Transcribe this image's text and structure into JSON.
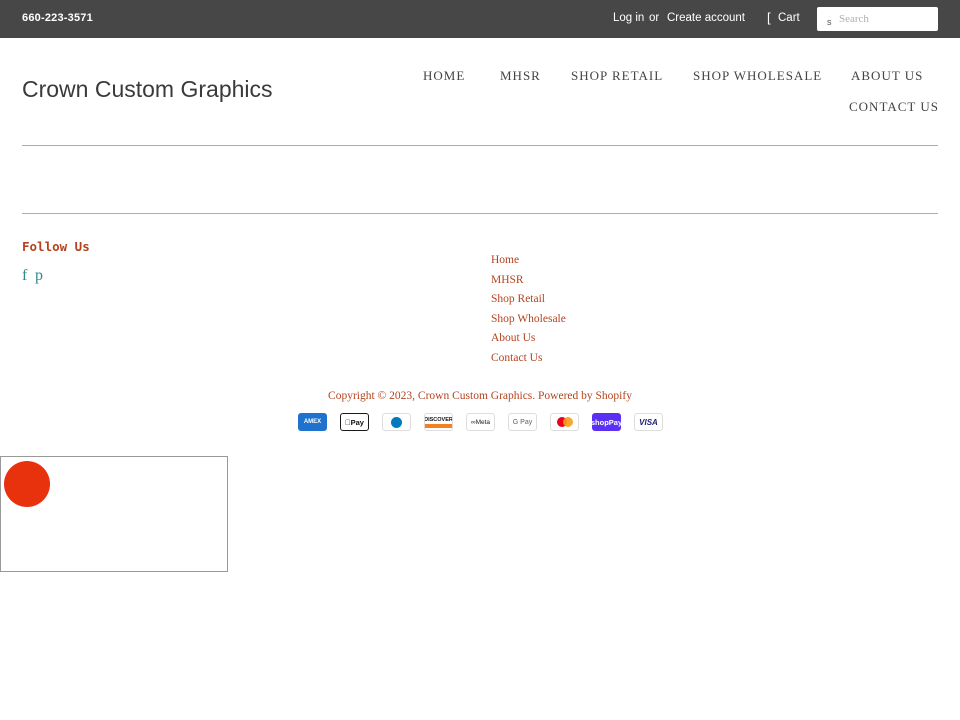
{
  "topbar": {
    "phone": "660-223-3571",
    "login_label": "Log in",
    "or_label": "or",
    "create_account_label": "Create account",
    "cart_icon_glyph": "[",
    "cart_label": "Cart",
    "search_icon_glyph": "s",
    "search_placeholder": "Search"
  },
  "header": {
    "logo_text": "Crown Custom Graphics"
  },
  "nav": {
    "items": [
      {
        "label": "HOME"
      },
      {
        "label": "MHSR"
      },
      {
        "label": "SHOP RETAIL"
      },
      {
        "label": "SHOP WHOLESALE"
      },
      {
        "label": "ABOUT US"
      },
      {
        "label": "CONTACT US"
      }
    ]
  },
  "footer": {
    "follow_heading": "Follow Us",
    "social": {
      "facebook_glyph": "f",
      "pinterest_glyph": "p"
    },
    "links": [
      {
        "label": "Home"
      },
      {
        "label": "MHSR"
      },
      {
        "label": "Shop Retail"
      },
      {
        "label": "Shop Wholesale"
      },
      {
        "label": "About Us"
      },
      {
        "label": "Contact Us"
      }
    ],
    "copyright_prefix": "Copyright © 2023, ",
    "copyright_store": "Crown Custom Graphics",
    "copyright_sep": ". ",
    "powered_by": "Powered by Shopify",
    "payment_methods": [
      {
        "name": "amex-icon",
        "text": "AMEX"
      },
      {
        "name": "apple-pay-icon",
        "text": "Pay"
      },
      {
        "name": "diners-club-icon",
        "text": ""
      },
      {
        "name": "discover-icon",
        "text": "DISCOVER"
      },
      {
        "name": "meta-pay-icon",
        "text": "Meta"
      },
      {
        "name": "google-pay-icon",
        "text": "G Pay"
      },
      {
        "name": "mastercard-icon",
        "text": ""
      },
      {
        "name": "shop-pay-icon",
        "text": "Pay"
      },
      {
        "name": "visa-icon",
        "text": "VISA"
      }
    ]
  },
  "colors": {
    "topbar_bg": "#474747",
    "accent_link": "#b5421e",
    "rule": "#7fbfbf",
    "social_icon": "#2e8a8a",
    "widget_circle": "#e8320e"
  }
}
